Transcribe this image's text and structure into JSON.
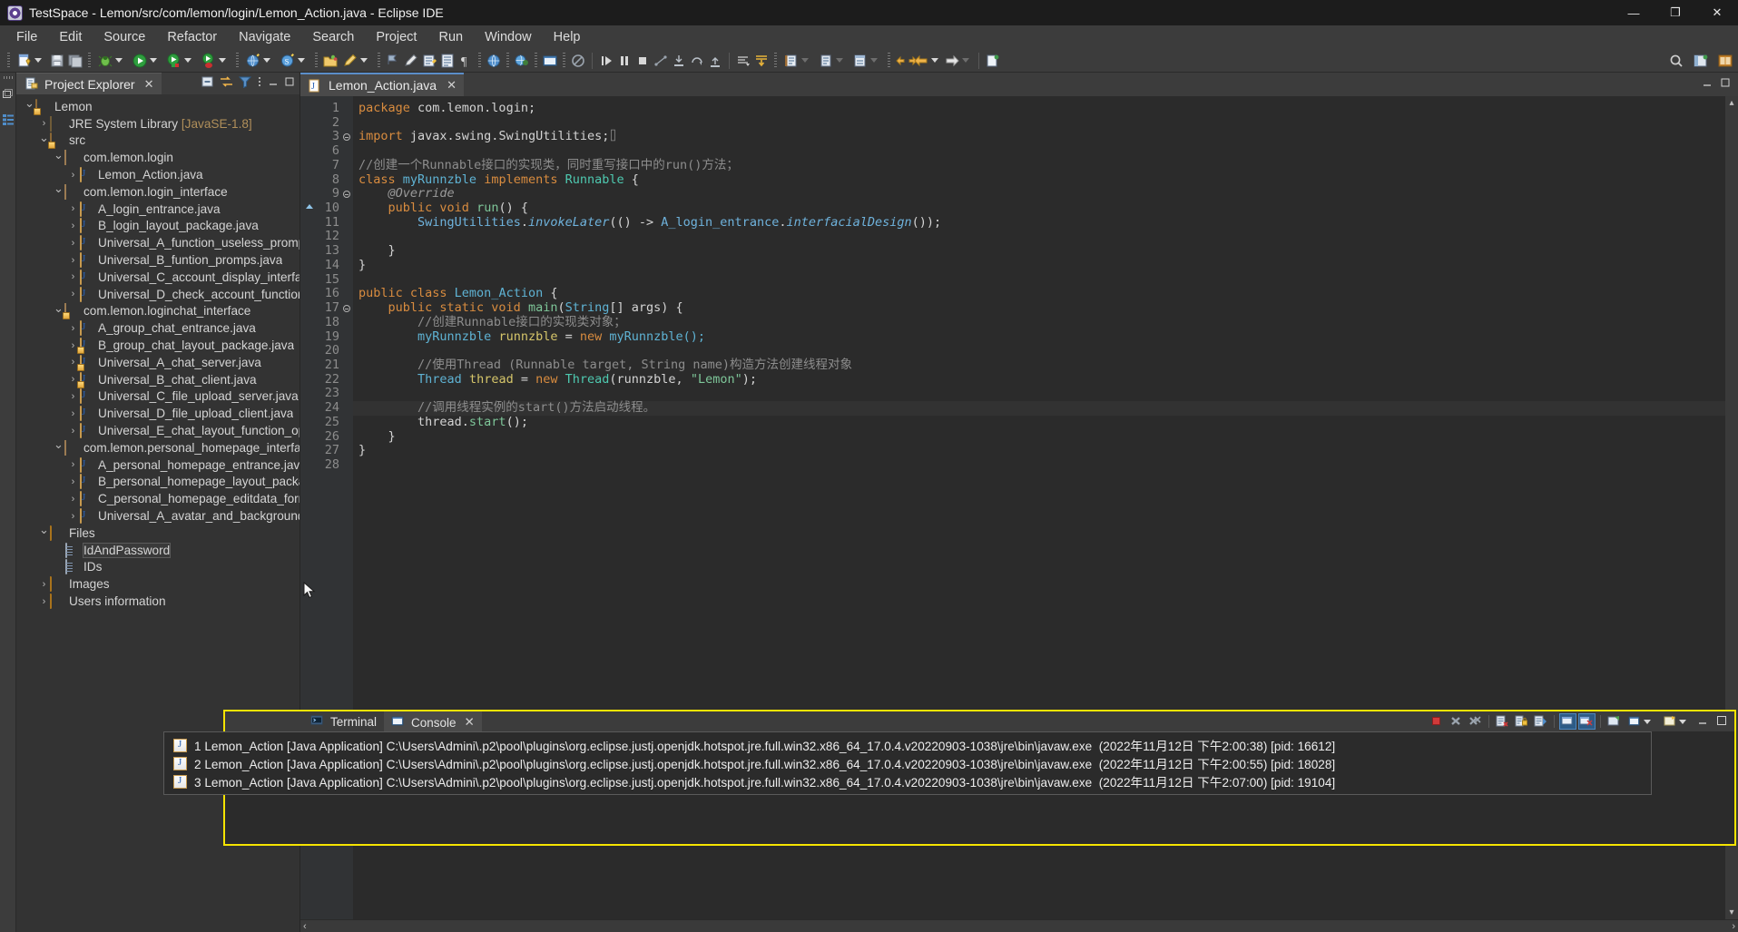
{
  "window": {
    "title": "TestSpace - Lemon/src/com/lemon/login/Lemon_Action.java - Eclipse IDE",
    "minimize": "—",
    "maximize": "❐",
    "close": "✕"
  },
  "menubar": [
    "File",
    "Edit",
    "Source",
    "Refactor",
    "Navigate",
    "Search",
    "Project",
    "Run",
    "Window",
    "Help"
  ],
  "explorer": {
    "tab_label": "Project Explorer",
    "tab_close": "✕",
    "tools": [
      "collapse-all-icon",
      "link-with-editor-icon",
      "view-filter-icon",
      "view-menu-icon",
      "minimize-icon",
      "maximize-icon"
    ],
    "tree": [
      {
        "label": "Lemon",
        "indent": 0,
        "twisty": "v",
        "icon": "project-icon"
      },
      {
        "label": "JRE System Library",
        "suffix": " [JavaSE-1.8]",
        "indent": 1,
        "twisty": ">",
        "icon": "jre-library-icon"
      },
      {
        "label": "src",
        "indent": 1,
        "twisty": "v",
        "icon": "source-folder-icon"
      },
      {
        "label": "com.lemon.login",
        "indent": 2,
        "twisty": "v",
        "icon": "package-icon"
      },
      {
        "label": "Lemon_Action.java",
        "indent": 3,
        "twisty": ">",
        "icon": "java-file-icon"
      },
      {
        "label": "com.lemon.login_interface",
        "indent": 2,
        "twisty": "v",
        "icon": "package-icon"
      },
      {
        "label": "A_login_entrance.java",
        "indent": 3,
        "twisty": ">",
        "icon": "java-file-icon"
      },
      {
        "label": "B_login_layout_package.java",
        "indent": 3,
        "twisty": ">",
        "icon": "java-file-icon"
      },
      {
        "label": "Universal_A_function_useless_prompt",
        "indent": 3,
        "twisty": ">",
        "icon": "java-file-icon"
      },
      {
        "label": "Universal_B_funtion_promps.java",
        "indent": 3,
        "twisty": ">",
        "icon": "java-file-icon"
      },
      {
        "label": "Universal_C_account_display_interface",
        "indent": 3,
        "twisty": ">",
        "icon": "java-file-icon"
      },
      {
        "label": "Universal_D_check_account_function.j",
        "indent": 3,
        "twisty": ">",
        "icon": "java-file-icon"
      },
      {
        "label": "com.lemon.loginchat_interface",
        "indent": 2,
        "twisty": "v",
        "icon": "package-locked-icon"
      },
      {
        "label": "A_group_chat_entrance.java",
        "indent": 3,
        "twisty": ">",
        "icon": "java-file-icon"
      },
      {
        "label": "B_group_chat_layout_package.java",
        "indent": 3,
        "twisty": ">",
        "icon": "java-file-locked-icon"
      },
      {
        "label": "Universal_A_chat_server.java",
        "indent": 3,
        "twisty": ">",
        "icon": "java-file-locked-icon"
      },
      {
        "label": "Universal_B_chat_client.java",
        "indent": 3,
        "twisty": ">",
        "icon": "java-file-locked-icon"
      },
      {
        "label": "Universal_C_file_upload_server.java",
        "indent": 3,
        "twisty": ">",
        "icon": "java-file-icon"
      },
      {
        "label": "Universal_D_file_upload_client.java",
        "indent": 3,
        "twisty": ">",
        "icon": "java-file-icon"
      },
      {
        "label": "Universal_E_chat_layout_function_opti",
        "indent": 3,
        "twisty": ">",
        "icon": "java-file-icon"
      },
      {
        "label": "com.lemon.personal_homepage_interfa",
        "indent": 2,
        "twisty": "v",
        "icon": "package-icon"
      },
      {
        "label": "A_personal_homepage_entrance.java",
        "indent": 3,
        "twisty": ">",
        "icon": "java-file-icon"
      },
      {
        "label": "B_personal_homepage_layout_packag",
        "indent": 3,
        "twisty": ">",
        "icon": "java-file-icon"
      },
      {
        "label": "C_personal_homepage_editdata_form",
        "indent": 3,
        "twisty": ">",
        "icon": "java-file-icon"
      },
      {
        "label": "Universal_A_avatar_and_background_",
        "indent": 3,
        "twisty": ">",
        "icon": "java-file-icon"
      },
      {
        "label": "Files",
        "indent": 1,
        "twisty": "v",
        "icon": "folder-icon"
      },
      {
        "label": "IdAndPassword",
        "indent": 2,
        "twisty": "",
        "icon": "text-file-icon",
        "selected": true
      },
      {
        "label": "IDs",
        "indent": 2,
        "twisty": "",
        "icon": "text-file-icon"
      },
      {
        "label": "Images",
        "indent": 1,
        "twisty": ">",
        "icon": "folder-icon"
      },
      {
        "label": "Users information",
        "indent": 1,
        "twisty": ">",
        "icon": "folder-icon"
      }
    ]
  },
  "editor": {
    "tab_label": "Lemon_Action.java",
    "tab_close": "✕",
    "lines": [
      {
        "n": "1",
        "marker": "",
        "tokens": [
          {
            "t": "package ",
            "c": "kw"
          },
          {
            "t": "com.lemon.login;",
            "c": ""
          }
        ]
      },
      {
        "n": "2",
        "marker": "",
        "tokens": []
      },
      {
        "n": "3",
        "marker": "fold",
        "tokens": [
          {
            "t": "import ",
            "c": "kw"
          },
          {
            "t": "javax.swing.SwingUtilities;",
            "c": ""
          },
          {
            "t": "⌷",
            "c": "cmt"
          }
        ]
      },
      {
        "n": "6",
        "marker": "",
        "tokens": []
      },
      {
        "n": "7",
        "marker": "",
        "tokens": [
          {
            "t": "//创建一个Runnable接口的实现类，同时重写接口中的run()方法；",
            "c": "cmt"
          }
        ]
      },
      {
        "n": "8",
        "marker": "",
        "tokens": [
          {
            "t": "class ",
            "c": "kw"
          },
          {
            "t": "myRunnzble ",
            "c": "cls2"
          },
          {
            "t": "implements ",
            "c": "kw"
          },
          {
            "t": "Runnable ",
            "c": "cls"
          },
          {
            "t": "{",
            "c": ""
          }
        ]
      },
      {
        "n": "9",
        "marker": "fold",
        "tokens": [
          {
            "t": "    @Override",
            "c": "ann"
          }
        ]
      },
      {
        "n": "10",
        "marker": "arrow",
        "tokens": [
          {
            "t": "    ",
            "c": ""
          },
          {
            "t": "public void ",
            "c": "kw"
          },
          {
            "t": "run",
            "c": "meth"
          },
          {
            "t": "() {",
            "c": ""
          }
        ]
      },
      {
        "n": "11",
        "marker": "",
        "tokens": [
          {
            "t": "        ",
            "c": ""
          },
          {
            "t": "SwingUtilities",
            "c": "lnk"
          },
          {
            "t": ".",
            "c": ""
          },
          {
            "t": "invokeLater",
            "c": "lnk italic"
          },
          {
            "t": "(() -> ",
            "c": ""
          },
          {
            "t": "A_login_entrance",
            "c": "lnk"
          },
          {
            "t": ".",
            "c": ""
          },
          {
            "t": "interfacialDesign",
            "c": "lnk italic"
          },
          {
            "t": "());",
            "c": ""
          }
        ]
      },
      {
        "n": "12",
        "marker": "",
        "tokens": []
      },
      {
        "n": "13",
        "marker": "",
        "tokens": [
          {
            "t": "    }",
            "c": ""
          }
        ]
      },
      {
        "n": "14",
        "marker": "",
        "tokens": [
          {
            "t": "}",
            "c": ""
          }
        ]
      },
      {
        "n": "15",
        "marker": "",
        "tokens": []
      },
      {
        "n": "16",
        "marker": "",
        "tokens": [
          {
            "t": "public class ",
            "c": "kw"
          },
          {
            "t": "Lemon_Action ",
            "c": "cls2"
          },
          {
            "t": "{",
            "c": ""
          }
        ]
      },
      {
        "n": "17",
        "marker": "fold",
        "tokens": [
          {
            "t": "    ",
            "c": ""
          },
          {
            "t": "public static void ",
            "c": "kw"
          },
          {
            "t": "main",
            "c": "meth"
          },
          {
            "t": "(",
            "c": ""
          },
          {
            "t": "String",
            "c": "cls2"
          },
          {
            "t": "[] args) {",
            "c": ""
          }
        ]
      },
      {
        "n": "18",
        "marker": "",
        "tokens": [
          {
            "t": "        //创建Runnable接口的实现类对象；",
            "c": "cmt"
          }
        ]
      },
      {
        "n": "19",
        "marker": "",
        "tokens": [
          {
            "t": "        ",
            "c": ""
          },
          {
            "t": "myRunnzble ",
            "c": "cls2"
          },
          {
            "t": "runnzble ",
            "c": "fld"
          },
          {
            "t": "= ",
            "c": ""
          },
          {
            "t": "new ",
            "c": "kw"
          },
          {
            "t": "myRunnzble();",
            "c": "cls2"
          }
        ]
      },
      {
        "n": "20",
        "marker": "",
        "tokens": []
      },
      {
        "n": "21",
        "marker": "",
        "tokens": [
          {
            "t": "        //使用Thread (Runnable target, String name)构造方法创建线程对象",
            "c": "cmt"
          }
        ]
      },
      {
        "n": "22",
        "marker": "",
        "tokens": [
          {
            "t": "        ",
            "c": ""
          },
          {
            "t": "Thread ",
            "c": "cls2"
          },
          {
            "t": "thread ",
            "c": "fld"
          },
          {
            "t": "= ",
            "c": ""
          },
          {
            "t": "new ",
            "c": "kw"
          },
          {
            "t": "Thread",
            "c": "cls"
          },
          {
            "t": "(runnzble, ",
            "c": ""
          },
          {
            "t": "\"Lemon\"",
            "c": "str"
          },
          {
            "t": ");",
            "c": ""
          }
        ]
      },
      {
        "n": "23",
        "marker": "",
        "tokens": []
      },
      {
        "n": "24",
        "marker": "",
        "highlight": true,
        "tokens": [
          {
            "t": "        //调用线程实例的start()方法启动线程。",
            "c": "cmt"
          }
        ]
      },
      {
        "n": "25",
        "marker": "",
        "tokens": [
          {
            "t": "        thread.",
            "c": ""
          },
          {
            "t": "start",
            "c": "meth"
          },
          {
            "t": "();",
            "c": ""
          }
        ]
      },
      {
        "n": "26",
        "marker": "",
        "tokens": [
          {
            "t": "    }",
            "c": ""
          }
        ]
      },
      {
        "n": "27",
        "marker": "",
        "tokens": [
          {
            "t": "}",
            "c": ""
          }
        ]
      },
      {
        "n": "28",
        "marker": "",
        "tokens": []
      }
    ],
    "scroll_left": "‹",
    "scroll_right": "›",
    "scroll_up": "▴",
    "scroll_down": "▾"
  },
  "console": {
    "tabs": [
      {
        "label": "Terminal",
        "icon": "terminal-icon",
        "active": false
      },
      {
        "label": "Console",
        "icon": "console-icon",
        "active": true,
        "close": "✕"
      }
    ],
    "tools": [
      "terminate-icon",
      "remove-launch-icon",
      "remove-all-terminated-icon",
      "clear-console-icon",
      "lock-scroll-icon",
      "show-console-on-output-icon",
      "pin-console-icon",
      "display-selected-console-icon",
      "open-console-icon",
      "new-console-view-icon",
      "minimize-icon",
      "maximize-icon"
    ],
    "dropdown_items": [
      {
        "num": "1",
        "name": "Lemon_Action",
        "type": "[Java Application]",
        "path": "C:\\Users\\Admini\\.p2\\pool\\plugins\\org.eclipse.justj.openjdk.hotspot.jre.full.win32.x86_64_17.0.4.v20220903-1038\\jre\\bin\\javaw.exe",
        "time": "(2022年11月12日 下午2:00:38)",
        "pid": "[pid: 16612]"
      },
      {
        "num": "2",
        "name": "Lemon_Action",
        "type": "[Java Application]",
        "path": "C:\\Users\\Admini\\.p2\\pool\\plugins\\org.eclipse.justj.openjdk.hotspot.jre.full.win32.x86_64_17.0.4.v20220903-1038\\jre\\bin\\javaw.exe",
        "time": "(2022年11月12日 下午2:00:55)",
        "pid": "[pid: 18028]"
      },
      {
        "num": "3",
        "name": "Lemon_Action",
        "type": "[Java Application]",
        "path": "C:\\Users\\Admini\\.p2\\pool\\plugins\\org.eclipse.justj.openjdk.hotspot.jre.full.win32.x86_64_17.0.4.v20220903-1038\\jre\\bin\\javaw.exe",
        "time": "(2022年11月12日 下午2:07:00)",
        "pid": "[pid: 19104]"
      }
    ]
  },
  "colors": {
    "accent": "#f5e400",
    "titlebar": "#1c1c1c",
    "chrome": "#3c3c3c",
    "editor_bg": "#2b2b2b",
    "panel_bg": "#333333"
  }
}
